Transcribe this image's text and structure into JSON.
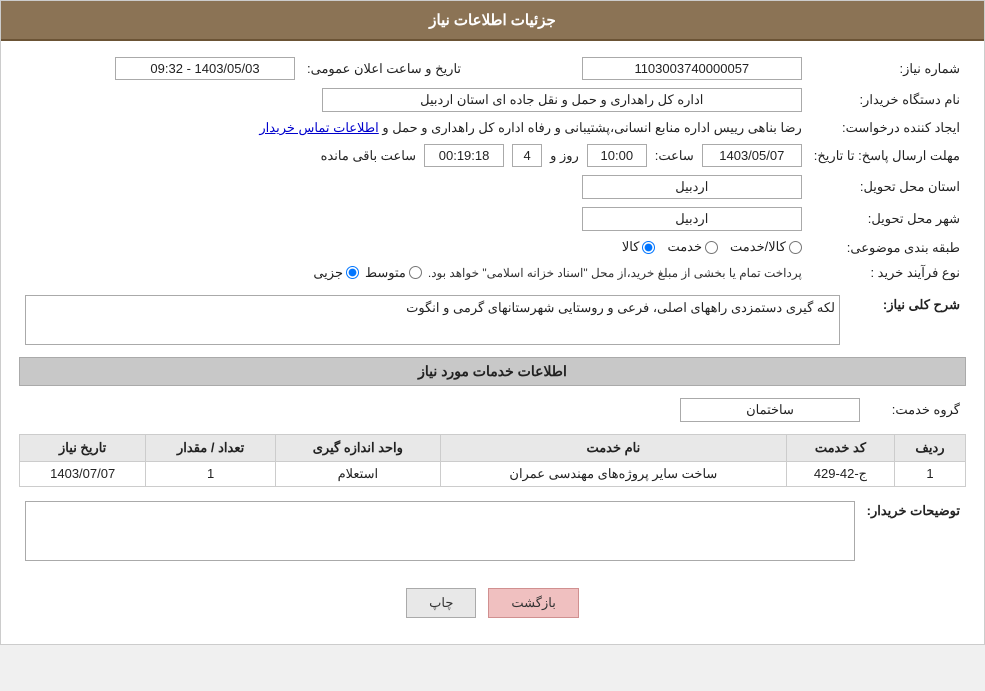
{
  "header": {
    "title": "جزئیات اطلاعات نیاز"
  },
  "fields": {
    "need_number_label": "شماره نیاز:",
    "need_number_value": "1103003740000057",
    "buyer_name_label": "نام دستگاه خریدار:",
    "buyer_name_value": "اداره کل راهداری و حمل و نقل جاده ای استان اردبیل",
    "created_by_label": "ایجاد کننده درخواست:",
    "created_by_value": "رضا بناهی رییس اداره منابع انسانی،پشتیبانی و رفاه اداره کل راهداری و حمل و",
    "contact_info_link": "اطلاعات تماس خریدار",
    "deadline_label": "مهلت ارسال پاسخ: تا تاریخ:",
    "date_value": "1403/05/07",
    "time_label": "ساعت:",
    "time_value": "10:00",
    "days_label": "روز و",
    "days_value": "4",
    "remaining_label": "ساعت باقی مانده",
    "remaining_value": "00:19:18",
    "announce_label": "تاریخ و ساعت اعلان عمومی:",
    "announce_value": "1403/05/03 - 09:32",
    "province_label": "استان محل تحویل:",
    "province_value": "اردبیل",
    "city_label": "شهر محل تحویل:",
    "city_value": "اردبیل",
    "category_label": "طبقه بندی موضوعی:",
    "category_kala": "کالا",
    "category_khadamat": "خدمت",
    "category_kala_khadamat": "کالا/خدمت",
    "process_label": "نوع فرآیند خرید :",
    "process_jozi": "جزیی",
    "process_motavaset": "متوسط",
    "process_full_text": "پرداخت تمام یا بخشی از مبلغ خرید،از محل \"اسناد خزانه اسلامی\" خواهد بود.",
    "description_label": "شرح کلی نیاز:",
    "description_value": "لکه گیری دستمزدی راههای اصلی، فرعی و روستایی شهرستانهای گرمی و انگوت",
    "services_section_title": "اطلاعات خدمات مورد نیاز",
    "service_group_label": "گروه خدمت:",
    "service_group_value": "ساختمان",
    "table_headers": {
      "row_num": "ردیف",
      "service_code": "کد خدمت",
      "service_name": "نام خدمت",
      "unit": "واحد اندازه گیری",
      "quantity": "تعداد / مقدار",
      "date": "تاریخ نیاز"
    },
    "table_rows": [
      {
        "row_num": "1",
        "service_code": "ج-42-429",
        "service_name": "ساخت سایر پروژه‌های مهندسی عمران",
        "unit": "استعلام",
        "quantity": "1",
        "date": "1403/07/07"
      }
    ],
    "buyer_notes_label": "توضیحات خریدار:",
    "buyer_notes_value": "",
    "btn_back": "بازگشت",
    "btn_print": "چاپ"
  }
}
